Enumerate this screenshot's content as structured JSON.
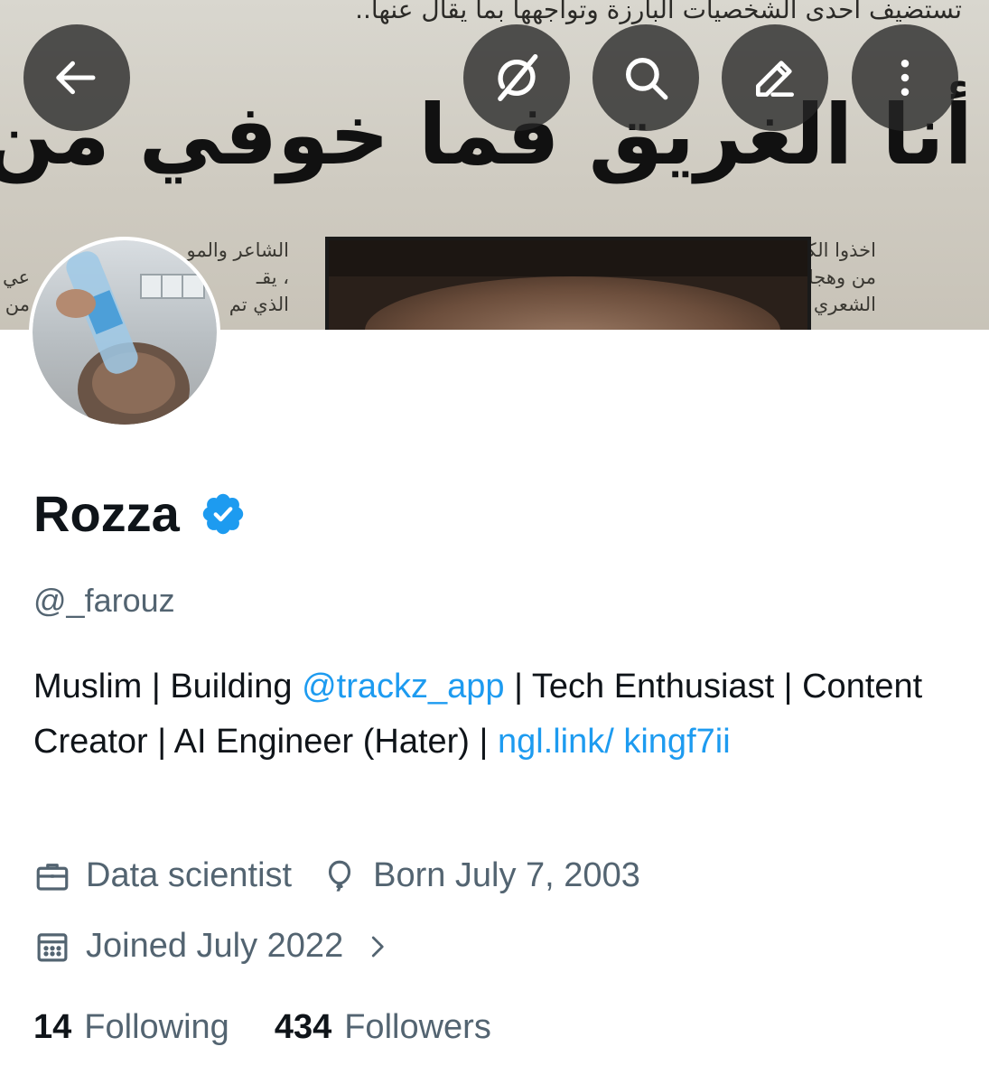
{
  "banner": {
    "top_line": "تستضيف احدى الشخصيات البارزة وتواجهها بما يقال عنها..",
    "headline": "أنا الغريق فما خوفي من البلل",
    "col_right_lines": [
      "اخذوا الكثير",
      "من وهجك",
      "الشعري"
    ],
    "col_left_lines": [
      "الشاعر والمو",
      "، يقـ",
      "الذي تم"
    ],
    "col_edge_lines": [
      "عي",
      "من"
    ]
  },
  "toolbar": {
    "back_icon": "arrow-left-icon",
    "grok_icon": "grok-icon",
    "search_icon": "search-icon",
    "edit_icon": "pencil-icon",
    "more_icon": "more-vertical-icon"
  },
  "profile": {
    "name": "Rozza",
    "verified": true,
    "handle": "@_farouz",
    "bio": {
      "part1": "Muslim | Building ",
      "mention": "@trackz_app",
      "part2": " | Tech Enthusiast | Content Creator | AI Engineer (Hater) | ",
      "link": "ngl.link/ kingf7ii"
    },
    "profession": "Data scientist",
    "birthday": "Born July 7, 2003",
    "joined": "Joined July 2022",
    "following_count": "14",
    "following_label": "Following",
    "followers_count": "434",
    "followers_label": "Followers"
  },
  "colors": {
    "accent": "#1d9bf0",
    "secondary_text": "#536471",
    "primary_text": "#0f1419"
  }
}
